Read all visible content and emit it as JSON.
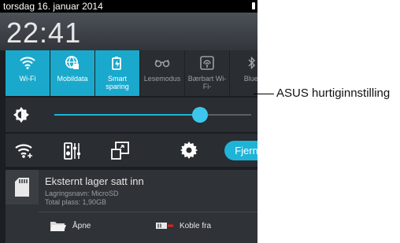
{
  "status_bar": {
    "date": "torsdag 16. januar 2014"
  },
  "clock": {
    "time": "22:41"
  },
  "quick_settings": {
    "tiles": [
      {
        "label": "Wi-Fi",
        "icon": "wifi-icon",
        "active": true
      },
      {
        "label": "Mobildata",
        "icon": "mobile-data-icon",
        "active": true
      },
      {
        "label": "Smart sparing",
        "icon": "smart-saving-icon",
        "active": true
      },
      {
        "label": "Lesemodus",
        "icon": "reading-mode-icon",
        "active": false
      },
      {
        "label": "Bærbart Wi-Fi-",
        "icon": "hotspot-icon",
        "active": false
      },
      {
        "label": "Bluet",
        "icon": "bluetooth-icon",
        "active": false
      }
    ],
    "brightness_level": 0.74,
    "fjern_label": "Fjern"
  },
  "notification": {
    "title": "Eksternt lager satt inn",
    "storage_name": "Lagringsnavn: MicroSD",
    "total_space": "Total plass: 1,90GB",
    "actions": [
      {
        "label": "Åpne",
        "icon": "folder-icon"
      },
      {
        "label": "Koble fra",
        "icon": "eject-sd-icon"
      }
    ]
  },
  "annotation": {
    "label": "ASUS hurtiginnstilling"
  },
  "colors": {
    "accent": "#1aa9cc",
    "panel": "#2a2d31",
    "background": "#1b1e22"
  }
}
